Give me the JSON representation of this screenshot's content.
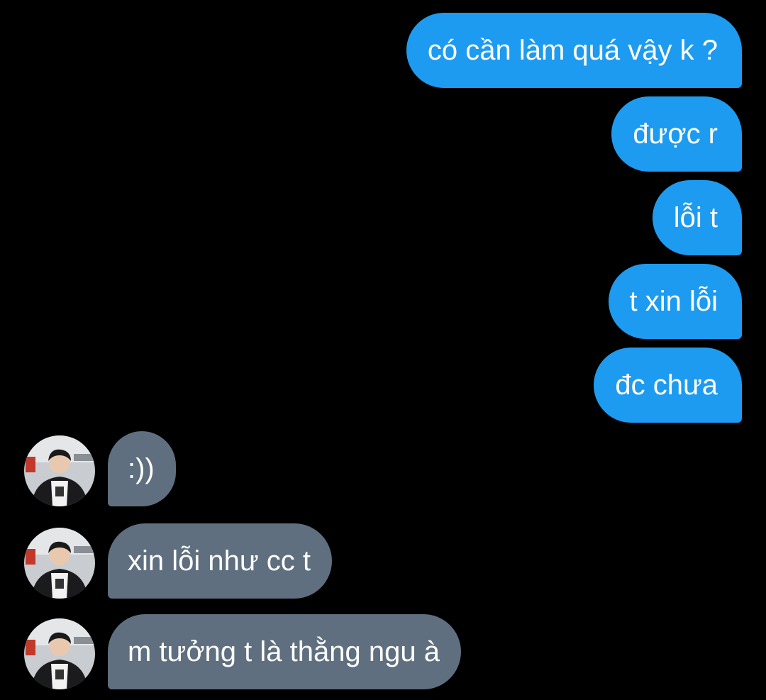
{
  "conversation": {
    "outgoing": [
      {
        "text": "có cần làm quá vậy k ?"
      },
      {
        "text": "được r"
      },
      {
        "text": "lỗi t"
      },
      {
        "text": "t xin lỗi"
      },
      {
        "text": "đc chưa"
      }
    ],
    "incoming": [
      {
        "text": ":))",
        "avatar": "user-avatar-photo"
      },
      {
        "text": "xin lỗi như cc t",
        "avatar": "user-avatar-photo"
      },
      {
        "text": "m tưởng t là thằng ngu à",
        "avatar": "user-avatar-photo"
      }
    ]
  },
  "colors": {
    "background": "#000000",
    "outgoing_bubble": "#1d9bf0",
    "incoming_bubble": "#5f6f7f",
    "text": "#ffffff"
  }
}
